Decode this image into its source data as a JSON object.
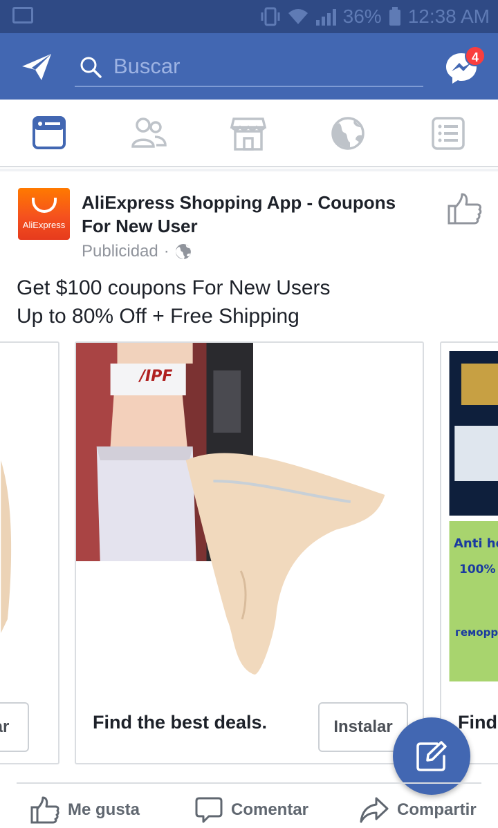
{
  "status_bar": {
    "battery": "36%",
    "time": "12:38 AM"
  },
  "header": {
    "search_placeholder": "Buscar",
    "messenger_badge": "4"
  },
  "nav_tabs": [
    {
      "name": "news-feed",
      "icon": "feed-icon",
      "active": true
    },
    {
      "name": "friends",
      "icon": "friends-icon",
      "active": false
    },
    {
      "name": "marketplace",
      "icon": "marketplace-icon",
      "active": false
    },
    {
      "name": "notifications",
      "icon": "globe-icon",
      "active": false
    },
    {
      "name": "menu",
      "icon": "menu-list-icon",
      "active": false
    }
  ],
  "post": {
    "logo_text": "AliExpress",
    "page_name": "AliExpress Shopping App - Coupons For New User",
    "meta_label": "Publicidad",
    "meta_separator": "·",
    "text_line1": "Get $100 coupons For New Users",
    "text_line2": "Up to 80% Off + Free Shipping"
  },
  "carousel": {
    "left_card_button": "alar",
    "main_card": {
      "image_text": "/IPF",
      "caption": "Find the best deals.",
      "button": "Instalar"
    },
    "right_card": {
      "image_text_1": "Anti he",
      "image_text_2": "100%",
      "image_text_3": "геморр",
      "caption": "Find"
    }
  },
  "actions": {
    "like": "Me gusta",
    "comment": "Comentar",
    "share": "Compartir"
  },
  "colors": {
    "brand_blue": "#4267b2",
    "status_bar": "#2f4a85",
    "badge_red": "#fa3e3e",
    "text_gray": "#90949c"
  }
}
